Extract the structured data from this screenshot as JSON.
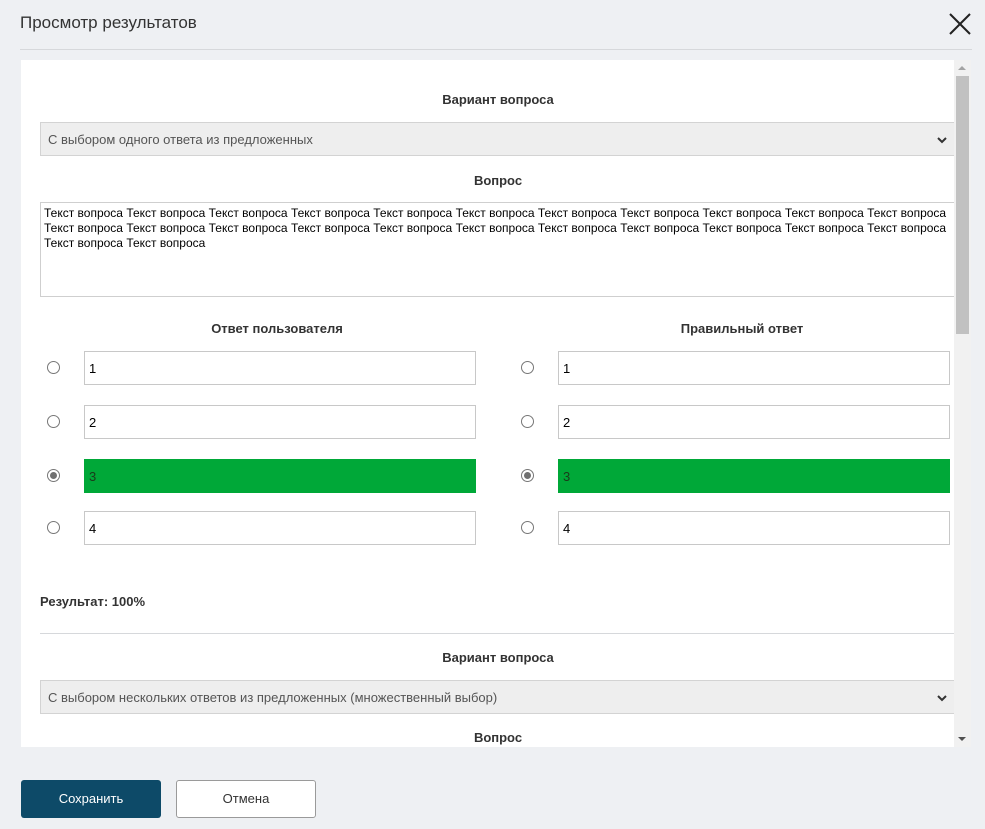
{
  "dialog": {
    "title": "Просмотр результатов",
    "close_icon": "close-icon"
  },
  "question1": {
    "type_heading": "Вариант вопроса",
    "type_value": "С выбором одного ответа из предложенных",
    "question_heading": "Вопрос",
    "question_text": "Текст вопроса Текст вопроса Текст вопроса Текст вопроса Текст вопроса Текст вопроса Текст вопроса Текст вопроса Текст вопроса Текст вопроса Текст вопроса Текст вопроса Текст вопроса Текст вопроса Текст вопроса Текст вопроса Текст вопроса Текст вопроса Текст вопроса Текст вопроса Текст вопроса Текст вопроса Текст вопроса Текст вопроса",
    "user_answer_heading": "Ответ пользователя",
    "correct_answer_heading": "Правильный ответ",
    "user_answers": [
      {
        "value": "1",
        "selected": false,
        "highlighted": false
      },
      {
        "value": "2",
        "selected": false,
        "highlighted": false
      },
      {
        "value": "3",
        "selected": true,
        "highlighted": true
      },
      {
        "value": "4",
        "selected": false,
        "highlighted": false
      }
    ],
    "correct_answers": [
      {
        "value": "1",
        "selected": false,
        "highlighted": false
      },
      {
        "value": "2",
        "selected": false,
        "highlighted": false
      },
      {
        "value": "3",
        "selected": true,
        "highlighted": true
      },
      {
        "value": "4",
        "selected": false,
        "highlighted": false
      }
    ],
    "result": "Результат: 100%"
  },
  "question2": {
    "type_heading": "Вариант вопроса",
    "type_value": "С выбором нескольких ответов из предложенных (множественный выбор)",
    "question_heading": "Вопрос"
  },
  "footer": {
    "save_label": "Сохранить",
    "cancel_label": "Отмена"
  },
  "colors": {
    "highlight": "#00a838",
    "primary_button": "#0d4a68"
  }
}
